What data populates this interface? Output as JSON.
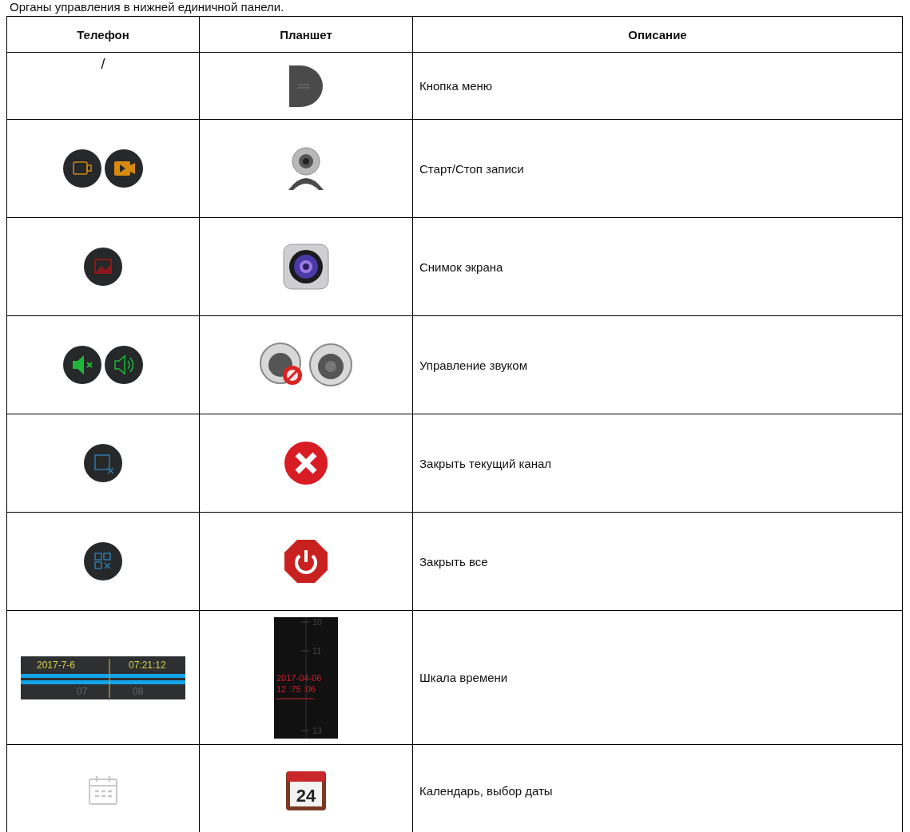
{
  "intro": "Органы управления в нижней единичной панели.",
  "table": {
    "columns": [
      "Телефон",
      "Планшет",
      "Описание"
    ],
    "rows": [
      {
        "kind": "menu",
        "phone": "/",
        "description": "Кнопка меню"
      },
      {
        "kind": "record",
        "description": "Старт/Стоп записи"
      },
      {
        "kind": "snapshot",
        "description": "Снимок экрана"
      },
      {
        "kind": "sound",
        "description": "Управление звуком"
      },
      {
        "kind": "close",
        "description": "Закрыть текущий канал"
      },
      {
        "kind": "close_all",
        "description": "Закрыть все"
      },
      {
        "kind": "timeline",
        "phone_timeline": {
          "date": "2017-7-6",
          "time": "07:21:12",
          "hours": [
            "07",
            "08"
          ]
        },
        "tablet_timeline": {
          "ticks": [
            "10",
            "11",
            "13"
          ],
          "date": "2017-04-06",
          "time": "12 :75 :06"
        },
        "description": "Шкала времени"
      },
      {
        "kind": "calendar",
        "tablet_day": "24",
        "description": "Календарь, выбор даты"
      }
    ]
  }
}
